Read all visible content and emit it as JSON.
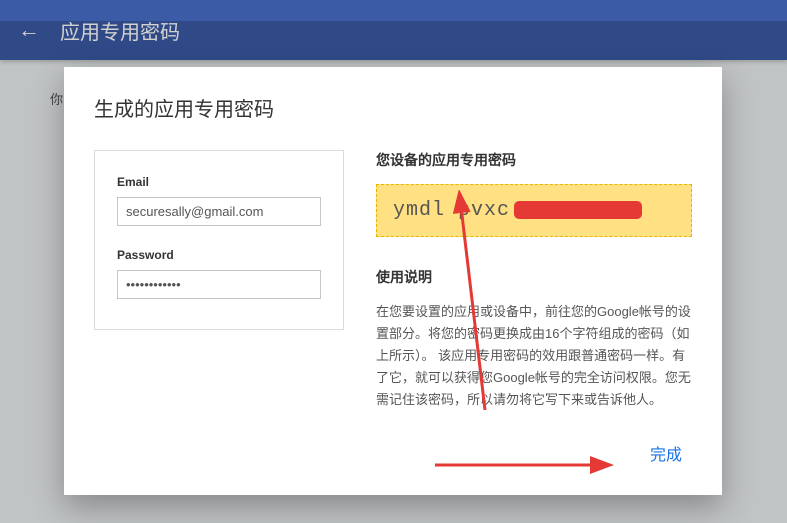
{
  "topbar": {
    "title": "应用专用密码"
  },
  "bg_hint": "你\n申",
  "modal": {
    "title": "生成的应用专用密码",
    "form": {
      "email_label": "Email",
      "email_value": "securesally@gmail.com",
      "password_label": "Password",
      "password_value": "••••••••••••"
    },
    "right": {
      "pwd_heading": "您设备的应用专用密码",
      "pwd_value": "ymdl pvxc",
      "instructions_heading": "使用说明",
      "instructions_body": "在您要设置的应用或设备中，前往您的Google帐号的设置部分。将您的密码更换成由16个字符组成的密码（如上所示）。\n该应用专用密码的效用跟普通密码一样。有了它，就可以获得您Google帐号的完全访问权限。您无需记住该密码，所以请勿将它写下来或告诉他人。"
    },
    "done_label": "完成"
  },
  "colors": {
    "primary": "#3b5ba7",
    "accent": "#1a73e8",
    "highlight_bg": "#ffe082",
    "redact": "#e53935"
  }
}
